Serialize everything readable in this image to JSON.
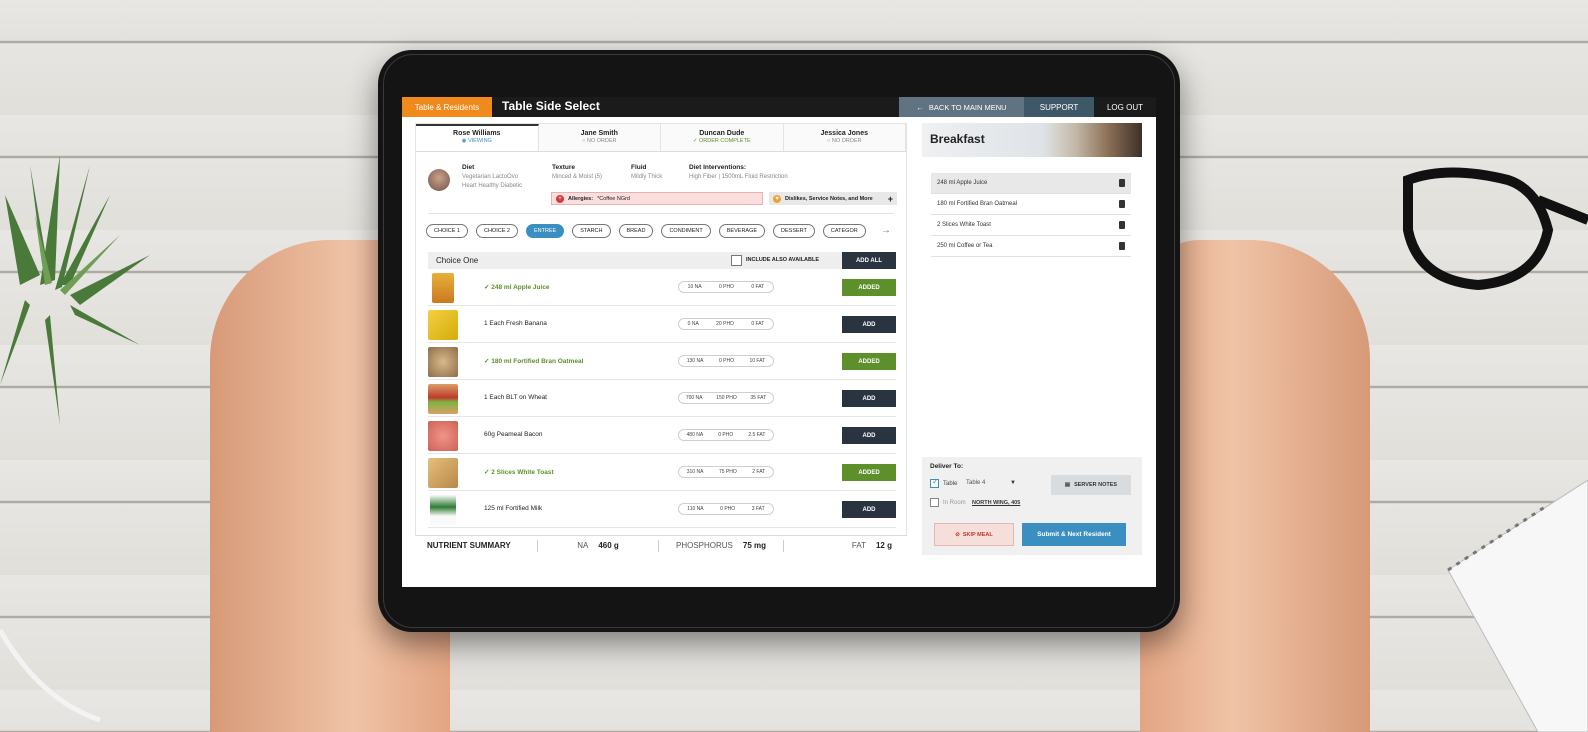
{
  "header": {
    "tab_label": "Table & Residents",
    "title": "Table Side Select",
    "back_label": "BACK TO MAIN MENU",
    "support_label": "SUPPORT",
    "logout_label": "LOG OUT"
  },
  "residents": [
    {
      "name": "Rose Williams",
      "status": "VIEWING"
    },
    {
      "name": "Jane Smith",
      "status": "NO ORDER"
    },
    {
      "name": "Duncan Dude",
      "status": "ORDER COMPLETE"
    },
    {
      "name": "Jessica Jones",
      "status": "NO ORDER"
    }
  ],
  "profile": {
    "diet_label": "Diet",
    "diet_value_1": "Vegetarian LactoOvo",
    "diet_value_2": "Heart Healthy Diabetic",
    "texture_label": "Texture",
    "texture_value": "Minced & Moist (5)",
    "fluid_label": "Fluid",
    "fluid_value": "Mildly Thick",
    "interventions_label": "Diet Interventions:",
    "interventions_value": "High Fiber | 1500mL Fluid Restriction",
    "allergies_label": "Allergies:",
    "allergies_value": "*Coffee NGrd",
    "dislikes_label": "Dislikes, Service Notes, and More"
  },
  "categories": [
    "CHOICE 1",
    "CHOICE 2",
    "ENTREE",
    "STARCH",
    "BREAD",
    "CONDIMENT",
    "BEVERAGE",
    "DESSERT",
    "CATEGOR"
  ],
  "active_category": "ENTREE",
  "choice": {
    "title": "Choice One",
    "include_label": "INCLUDE ALSO AVAILABLE",
    "add_all_label": "ADD ALL"
  },
  "menu_items": [
    {
      "name": "248 ml Apple Juice",
      "na": "10 NA",
      "pho": "0 PHO",
      "fat": "0 FAT",
      "action": "ADDED"
    },
    {
      "name": "1 Each Fresh Banana",
      "na": "0 NA",
      "pho": "20 PHO",
      "fat": "0 FAT",
      "action": "ADD"
    },
    {
      "name": "180 ml Fortified Bran Oatmeal",
      "na": "130 NA",
      "pho": "0 PHO",
      "fat": "10 FAT",
      "action": "ADDED"
    },
    {
      "name": "1 Each BLT on Wheat",
      "na": "700 NA",
      "pho": "150 PHO",
      "fat": "35 FAT",
      "action": "ADD"
    },
    {
      "name": "60g Peameal Bacon",
      "na": "480 NA",
      "pho": "0 PHO",
      "fat": "2.5 FAT",
      "action": "ADD"
    },
    {
      "name": "2 Slices White Toast",
      "na": "310 NA",
      "pho": "75 PHO",
      "fat": "2 FAT",
      "action": "ADDED"
    },
    {
      "name": "125 ml Fortified Milk",
      "na": "110 NA",
      "pho": "0 PHO",
      "fat": "3 FAT",
      "action": "ADD"
    }
  ],
  "summary": {
    "title": "NUTRIENT SUMMARY",
    "na_label": "NA",
    "na_value": "460 g",
    "pho_label": "PHOSPHORUS",
    "pho_value": "75 mg",
    "fat_label": "FAT",
    "fat_value": "12 g"
  },
  "meal": {
    "title": "Breakfast",
    "orders": [
      "248 ml Apple Juice",
      "180 ml Fortified Bran Oatmeal",
      "2 Slices White Toast",
      "250 ml Coffee or Tea"
    ],
    "deliver_label": "Deliver To:",
    "table_label": "Table",
    "table_value": "Table 4",
    "room_label": "In Room",
    "room_value": "NORTH WING, 405",
    "server_notes_label": "SERVER NOTES",
    "skip_label": "SKIP MEAL",
    "submit_label": "Submit & Next Resident"
  },
  "colors": {
    "accent_orange": "#f08a1c",
    "accent_blue": "#3a8fc0",
    "added_green": "#5d8f2b",
    "dark_button": "#2a3440"
  }
}
